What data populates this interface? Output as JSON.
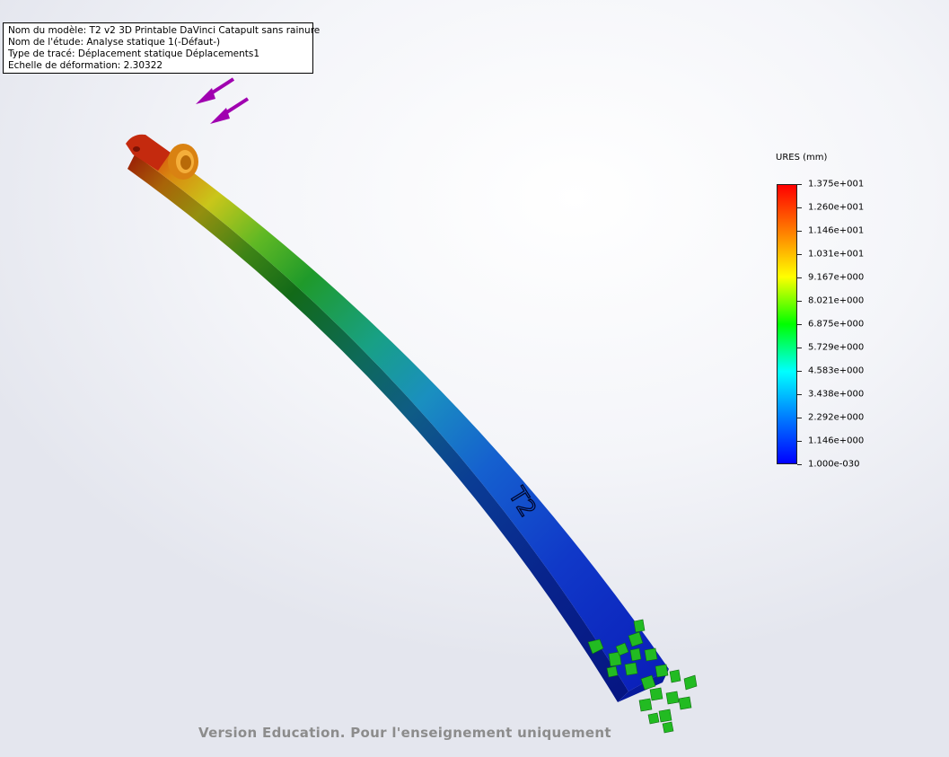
{
  "info_box": {
    "model_name": "Nom du modèle: T2 v2 3D Printable DaVinci Catapult sans rainure",
    "study_name": "Nom de l'étude: Analyse statique 1(-Défaut-)",
    "plot_type": "Type de tracé: Déplacement statique Déplacements1",
    "deformation_scale": "Echelle de déformation: 2.30322"
  },
  "legend": {
    "title": "URES (mm)",
    "labels": [
      "1.375e+001",
      "1.260e+001",
      "1.146e+001",
      "1.031e+001",
      "9.167e+000",
      "8.021e+000",
      "6.875e+000",
      "5.729e+000",
      "4.583e+000",
      "3.438e+000",
      "2.292e+000",
      "1.146e+000",
      "1.000e-030"
    ],
    "colors": [
      "#ff0000",
      "#ff8000",
      "#ffff00",
      "#00ff00",
      "#00ffff",
      "#0080ff",
      "#0000ff"
    ]
  },
  "model": {
    "engraved_text": "T2",
    "load_arrow_color": "#a000b0",
    "fixture_color": "#22bb22"
  },
  "watermark": "Version Education. Pour l'enseignement uniquement"
}
